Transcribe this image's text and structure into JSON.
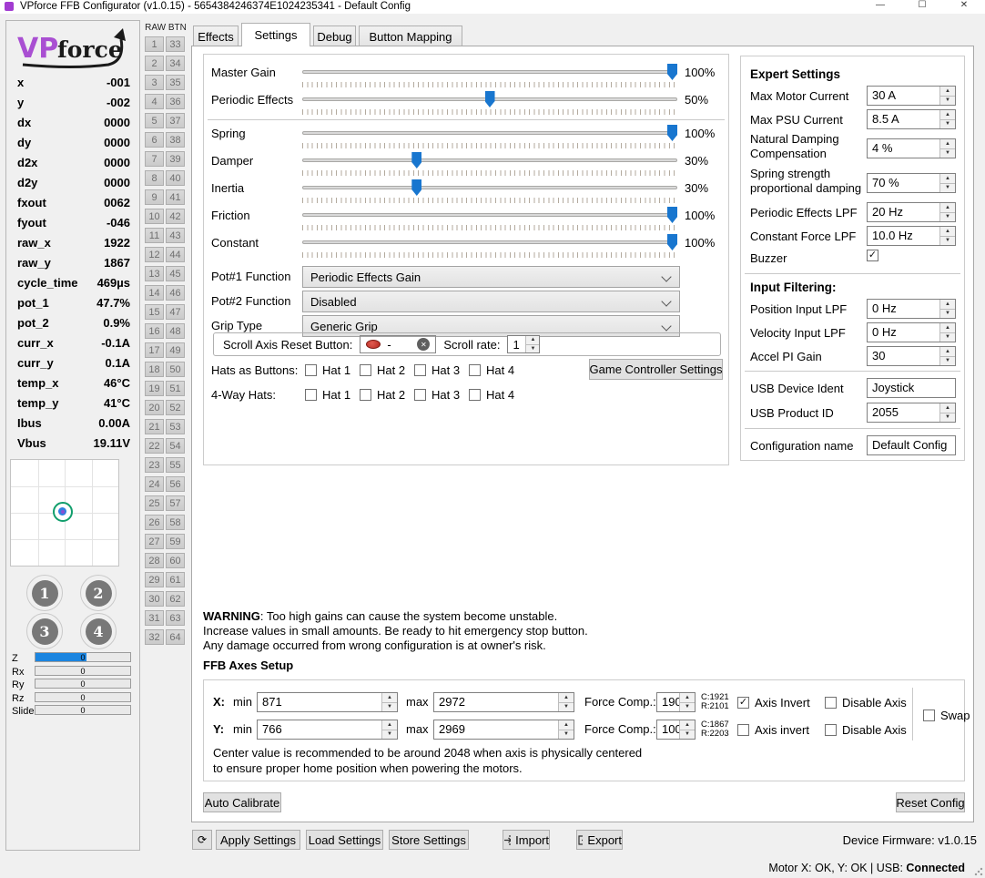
{
  "title_bar": {
    "title": "VPforce FFB Configurator (v1.0.15) - 5654384246374E1024235341 - Default Config"
  },
  "icons": {
    "minimize": "—",
    "maximize": "☐",
    "close": "✕",
    "refresh": "⟳",
    "spin_up": "▲",
    "spin_down": "▼",
    "check": "✓",
    "clear": "✕"
  },
  "colors": {
    "accent_blue": "#1876cf",
    "bar_blue": "#1b85e0",
    "logo_purple": "#a94fd2",
    "red_button": "#c5352c"
  },
  "telemetry": {
    "rows": [
      {
        "label": "x",
        "value": "-001"
      },
      {
        "label": "y",
        "value": "-002"
      },
      {
        "label": "dx",
        "value": "0000"
      },
      {
        "label": "dy",
        "value": "0000"
      },
      {
        "label": "d2x",
        "value": "0000"
      },
      {
        "label": "d2y",
        "value": "0000"
      },
      {
        "label": "fxout",
        "value": "0062"
      },
      {
        "label": "fyout",
        "value": "-046"
      },
      {
        "label": "raw_x",
        "value": "1922"
      },
      {
        "label": "raw_y",
        "value": "1867"
      },
      {
        "label": "cycle_time",
        "value": "469µs"
      },
      {
        "label": "pot_1",
        "value": "47.7%"
      },
      {
        "label": "pot_2",
        "value": "0.9%"
      },
      {
        "label": "curr_x",
        "value": "-0.1A"
      },
      {
        "label": "curr_y",
        "value": "0.1A"
      },
      {
        "label": "temp_x",
        "value": "46°C"
      },
      {
        "label": "temp_y",
        "value": "41°C"
      },
      {
        "label": "Ibus",
        "value": "0.00A"
      },
      {
        "label": "Vbus",
        "value": "19.11V"
      }
    ]
  },
  "xy_plot": {
    "marker_x_percent": 48,
    "marker_y_percent": 49
  },
  "joystick_buttons": [
    "1",
    "2",
    "3",
    "4"
  ],
  "axis_bars": [
    {
      "label": "Z",
      "value": "0",
      "fill_percent": 54
    },
    {
      "label": "Rx",
      "value": "0",
      "fill_percent": 0
    },
    {
      "label": "Ry",
      "value": "0",
      "fill_percent": 0
    },
    {
      "label": "Rz",
      "value": "0",
      "fill_percent": 0
    },
    {
      "label": "Slider",
      "value": "0",
      "fill_percent": 0
    }
  ],
  "raw_btn": {
    "header": "RAW BTN",
    "col1": [
      1,
      2,
      3,
      4,
      5,
      6,
      7,
      8,
      9,
      10,
      11,
      12,
      13,
      14,
      15,
      16,
      17,
      18,
      19,
      20,
      21,
      22,
      23,
      24,
      25,
      26,
      27,
      28,
      29,
      30,
      31,
      32
    ],
    "col2": [
      33,
      34,
      35,
      36,
      37,
      38,
      39,
      40,
      41,
      42,
      43,
      44,
      45,
      46,
      47,
      48,
      49,
      50,
      51,
      52,
      53,
      54,
      55,
      56,
      57,
      58,
      59,
      60,
      61,
      62,
      63,
      64
    ]
  },
  "tabs": [
    {
      "label": "Effects",
      "active": false
    },
    {
      "label": "Settings",
      "active": true
    },
    {
      "label": "Debug",
      "active": false
    },
    {
      "label": "Button Mapping",
      "active": false
    }
  ],
  "sliders": [
    {
      "label": "Master Gain",
      "percent": 100,
      "display": "100%"
    },
    {
      "label": "Periodic Effects",
      "percent": 50,
      "display": "50%"
    },
    {
      "label": "Spring",
      "percent": 100,
      "display": "100%"
    },
    {
      "label": "Damper",
      "percent": 30,
      "display": "30%"
    },
    {
      "label": "Inertia",
      "percent": 30,
      "display": "30%"
    },
    {
      "label": "Friction",
      "percent": 100,
      "display": "100%"
    },
    {
      "label": "Constant",
      "percent": 100,
      "display": "100%"
    }
  ],
  "dropdowns": [
    {
      "label": "Pot#1 Function",
      "value": "Periodic Effects Gain"
    },
    {
      "label": "Pot#2 Function",
      "value": "Disabled"
    },
    {
      "label": "Grip Type",
      "value": "Generic Grip"
    }
  ],
  "scroll_axis": {
    "label": "Scroll Axis Reset Button:",
    "assignment": "-",
    "rate_label": "Scroll rate:",
    "rate_value": "1"
  },
  "hats": {
    "as_buttons_label": "Hats as Buttons:",
    "four_way_label": "4-Way Hats:",
    "options": [
      "Hat 1",
      "Hat 2",
      "Hat 3",
      "Hat 4"
    ],
    "as_buttons_checked": [
      false,
      false,
      false,
      false
    ],
    "four_way_checked": [
      false,
      false,
      false,
      false
    ],
    "game_controller_button": "Game Controller Settings"
  },
  "expert_settings": {
    "title": "Expert Settings",
    "fields": [
      {
        "label": "Max Motor Current",
        "value": "30 A",
        "type": "spin"
      },
      {
        "label": "Max PSU Current",
        "value": "8.5 A",
        "type": "spin"
      },
      {
        "label": "Natural Damping Compensation",
        "value": "4 %",
        "type": "spin"
      },
      {
        "label": "Spring strength proportional damping",
        "value": "70 %",
        "type": "spin"
      },
      {
        "label": "Periodic Effects LPF",
        "value": "20 Hz",
        "type": "spin"
      },
      {
        "label": "Constant Force LPF",
        "value": "10.0 Hz",
        "type": "spin"
      },
      {
        "label": "Buzzer",
        "checked": true,
        "type": "checkbox"
      }
    ],
    "input_filtering_title": "Input Filtering:",
    "input_filtering": [
      {
        "label": "Position Input LPF",
        "value": "0 Hz",
        "type": "spin"
      },
      {
        "label": "Velocity Input LPF",
        "value": "0 Hz",
        "type": "spin"
      },
      {
        "label": "Accel PI Gain",
        "value": "30",
        "type": "spin"
      }
    ],
    "usb": [
      {
        "label": "USB Device Ident",
        "value": "Joystick",
        "type": "text"
      },
      {
        "label": "USB Product ID",
        "value": "2055",
        "type": "spin"
      }
    ],
    "config": [
      {
        "label": "Configuration name",
        "value": "Default Config",
        "type": "text"
      }
    ]
  },
  "warning": {
    "bold": "WARNING",
    "line1": ": Too high gains can cause the system become unstable.",
    "line2": "Increase values in small amounts. Be ready to hit emergency stop button.",
    "line3": "Any damage occurred from wrong configuration is at owner's risk."
  },
  "ffb_axes": {
    "title": "FFB Axes Setup",
    "min_label": "min",
    "max_label": "max",
    "force_label": "Force Comp.:",
    "rows": [
      {
        "axis": "X:",
        "min": "871",
        "max": "2972",
        "force": "190",
        "c": "C:1921",
        "r": "R:2101",
        "invert_label": "Axis Invert",
        "invert_checked": true,
        "disable_label": "Disable Axis",
        "disable_checked": false
      },
      {
        "axis": "Y:",
        "min": "766",
        "max": "2969",
        "force": "100",
        "c": "C:1867",
        "r": "R:2203",
        "invert_label": "Axis invert",
        "invert_checked": false,
        "disable_label": "Disable Axis",
        "disable_checked": false
      }
    ],
    "swap_label": "Swap",
    "swap_checked": false,
    "note_line1": "Center value is recommended to be around 2048 when axis is physically centered",
    "note_line2": "to ensure proper home position when powering the motors."
  },
  "actions": {
    "auto_calibrate": "Auto Calibrate",
    "reset_config": "Reset Config"
  },
  "toolbar": {
    "apply": "Apply Settings",
    "load": "Load Settings",
    "store": "Store Settings",
    "import": "Import",
    "export": "Export",
    "firmware": "Device Firmware: v1.0.15"
  },
  "status_bar": {
    "text": "Motor X: OK, Y: OK | USB: ",
    "connected": "Connected"
  }
}
